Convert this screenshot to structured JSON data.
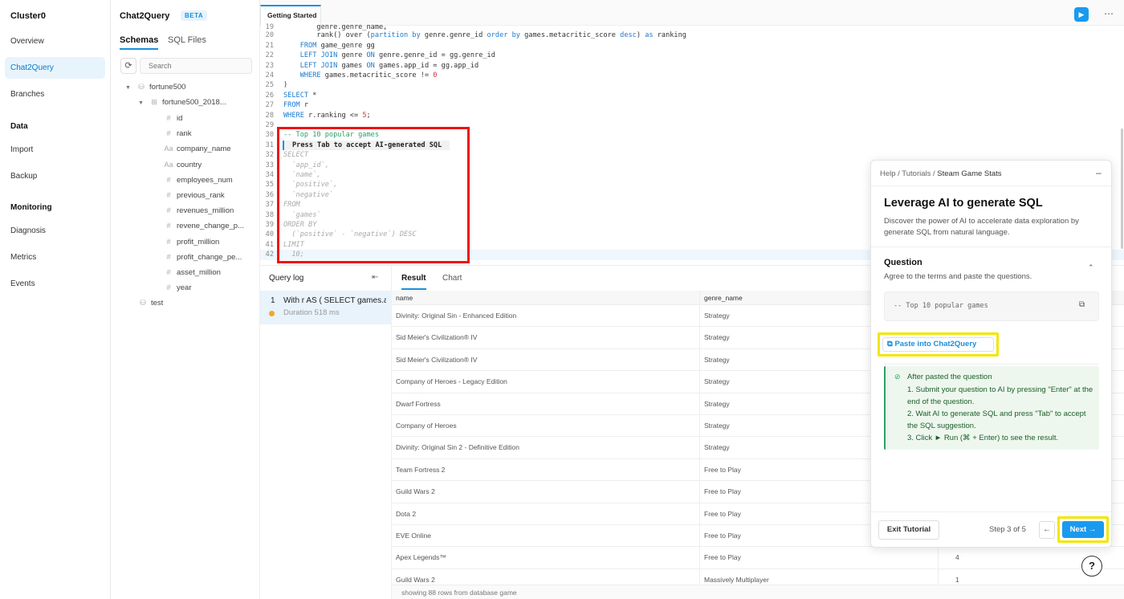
{
  "nav": {
    "cluster": "Cluster0",
    "overview": "Overview",
    "chat2query": "Chat2Query",
    "branches": "Branches",
    "data_section": "Data",
    "import": "Import",
    "backup": "Backup",
    "monitoring_section": "Monitoring",
    "diagnosis": "Diagnosis",
    "metrics": "Metrics",
    "events": "Events"
  },
  "schema": {
    "title": "Chat2Query",
    "beta": "BETA",
    "tab_schemas": "Schemas",
    "tab_sql_files": "SQL Files",
    "search_placeholder": "Search",
    "db1": "fortune500",
    "table1": "fortune500_2018...",
    "columns": [
      "id",
      "rank",
      "company_name",
      "country",
      "employees_num",
      "previous_rank",
      "revenues_million",
      "revene_change_p...",
      "profit_million",
      "profit_change_pe...",
      "asset_million",
      "year"
    ],
    "column_icons": [
      "#",
      "#",
      "Aa",
      "Aa",
      "#",
      "#",
      "#",
      "#",
      "#",
      "#",
      "#",
      "#"
    ],
    "db2": "test"
  },
  "editor": {
    "tab": "Getting Started",
    "hint": "Press Tab to accept AI-generated SQL",
    "line_numbers": [
      "19",
      "20",
      "21",
      "22",
      "23",
      "24",
      "25",
      "26",
      "27",
      "28",
      "29",
      "30",
      "31",
      "32",
      "33",
      "34",
      "35",
      "36",
      "37",
      "38",
      "39",
      "40",
      "41",
      "42"
    ]
  },
  "qlog": {
    "title": "Query log",
    "n": "1",
    "query": "With r AS ( SELECT games.app_id",
    "duration": "Duration 518 ms"
  },
  "result": {
    "tab_result": "Result",
    "tab_chart": "Chart",
    "col_name": "name",
    "col_genre": "genre_name",
    "rows": [
      {
        "name": "Divinity: Original Sin - Enhanced Edition",
        "genre": "Strategy",
        "rank": ""
      },
      {
        "name": "Sid Meier's Civilization® IV",
        "genre": "Strategy",
        "rank": ""
      },
      {
        "name": "Sid Meier's Civilization® IV",
        "genre": "Strategy",
        "rank": ""
      },
      {
        "name": "Company of Heroes - Legacy Edition",
        "genre": "Strategy",
        "rank": ""
      },
      {
        "name": "Dwarf Fortress",
        "genre": "Strategy",
        "rank": ""
      },
      {
        "name": "Company of Heroes",
        "genre": "Strategy",
        "rank": ""
      },
      {
        "name": "Divinity: Original Sin 2 - Definitive Edition",
        "genre": "Strategy",
        "rank": ""
      },
      {
        "name": "Team Fortress 2",
        "genre": "Free to Play",
        "rank": ""
      },
      {
        "name": "Guild Wars 2",
        "genre": "Free to Play",
        "rank": ""
      },
      {
        "name": "Dota 2",
        "genre": "Free to Play",
        "rank": ""
      },
      {
        "name": "EVE Online",
        "genre": "Free to Play",
        "rank": ""
      },
      {
        "name": "Apex Legends™",
        "genre": "Free to Play",
        "rank": "4"
      },
      {
        "name": "Guild Wars 2",
        "genre": "Massively Multiplayer",
        "rank": "1"
      }
    ],
    "footer": "showing 88 rows from database game"
  },
  "tutorial": {
    "crumb_help": "Help",
    "crumb_tutorials": "Tutorials",
    "crumb_page": "Steam Game Stats",
    "heading": "Leverage AI to generate SQL",
    "desc": "Discover the power of AI to accelerate data exploration by generate SQL from natural language.",
    "question_title": "Question",
    "question_sub": "Agree to the terms and paste the questions.",
    "question_code": "-- Top 10 popular games",
    "paste_label": "Paste into Chat2Query",
    "steps_header": "After pasted the question",
    "step1": "1. Submit your question to AI by pressing \"Enter\" at the end of the question.",
    "step2": "2. Wait AI to generate SQL and press \"Tab\" to accept the SQL suggestion.",
    "step3": "3. Click ► Run (⌘ + Enter) to see the result.",
    "exit": "Exit Tutorial",
    "step_info": "Step 3 of 5",
    "next": "Next →"
  },
  "help_label": "?"
}
